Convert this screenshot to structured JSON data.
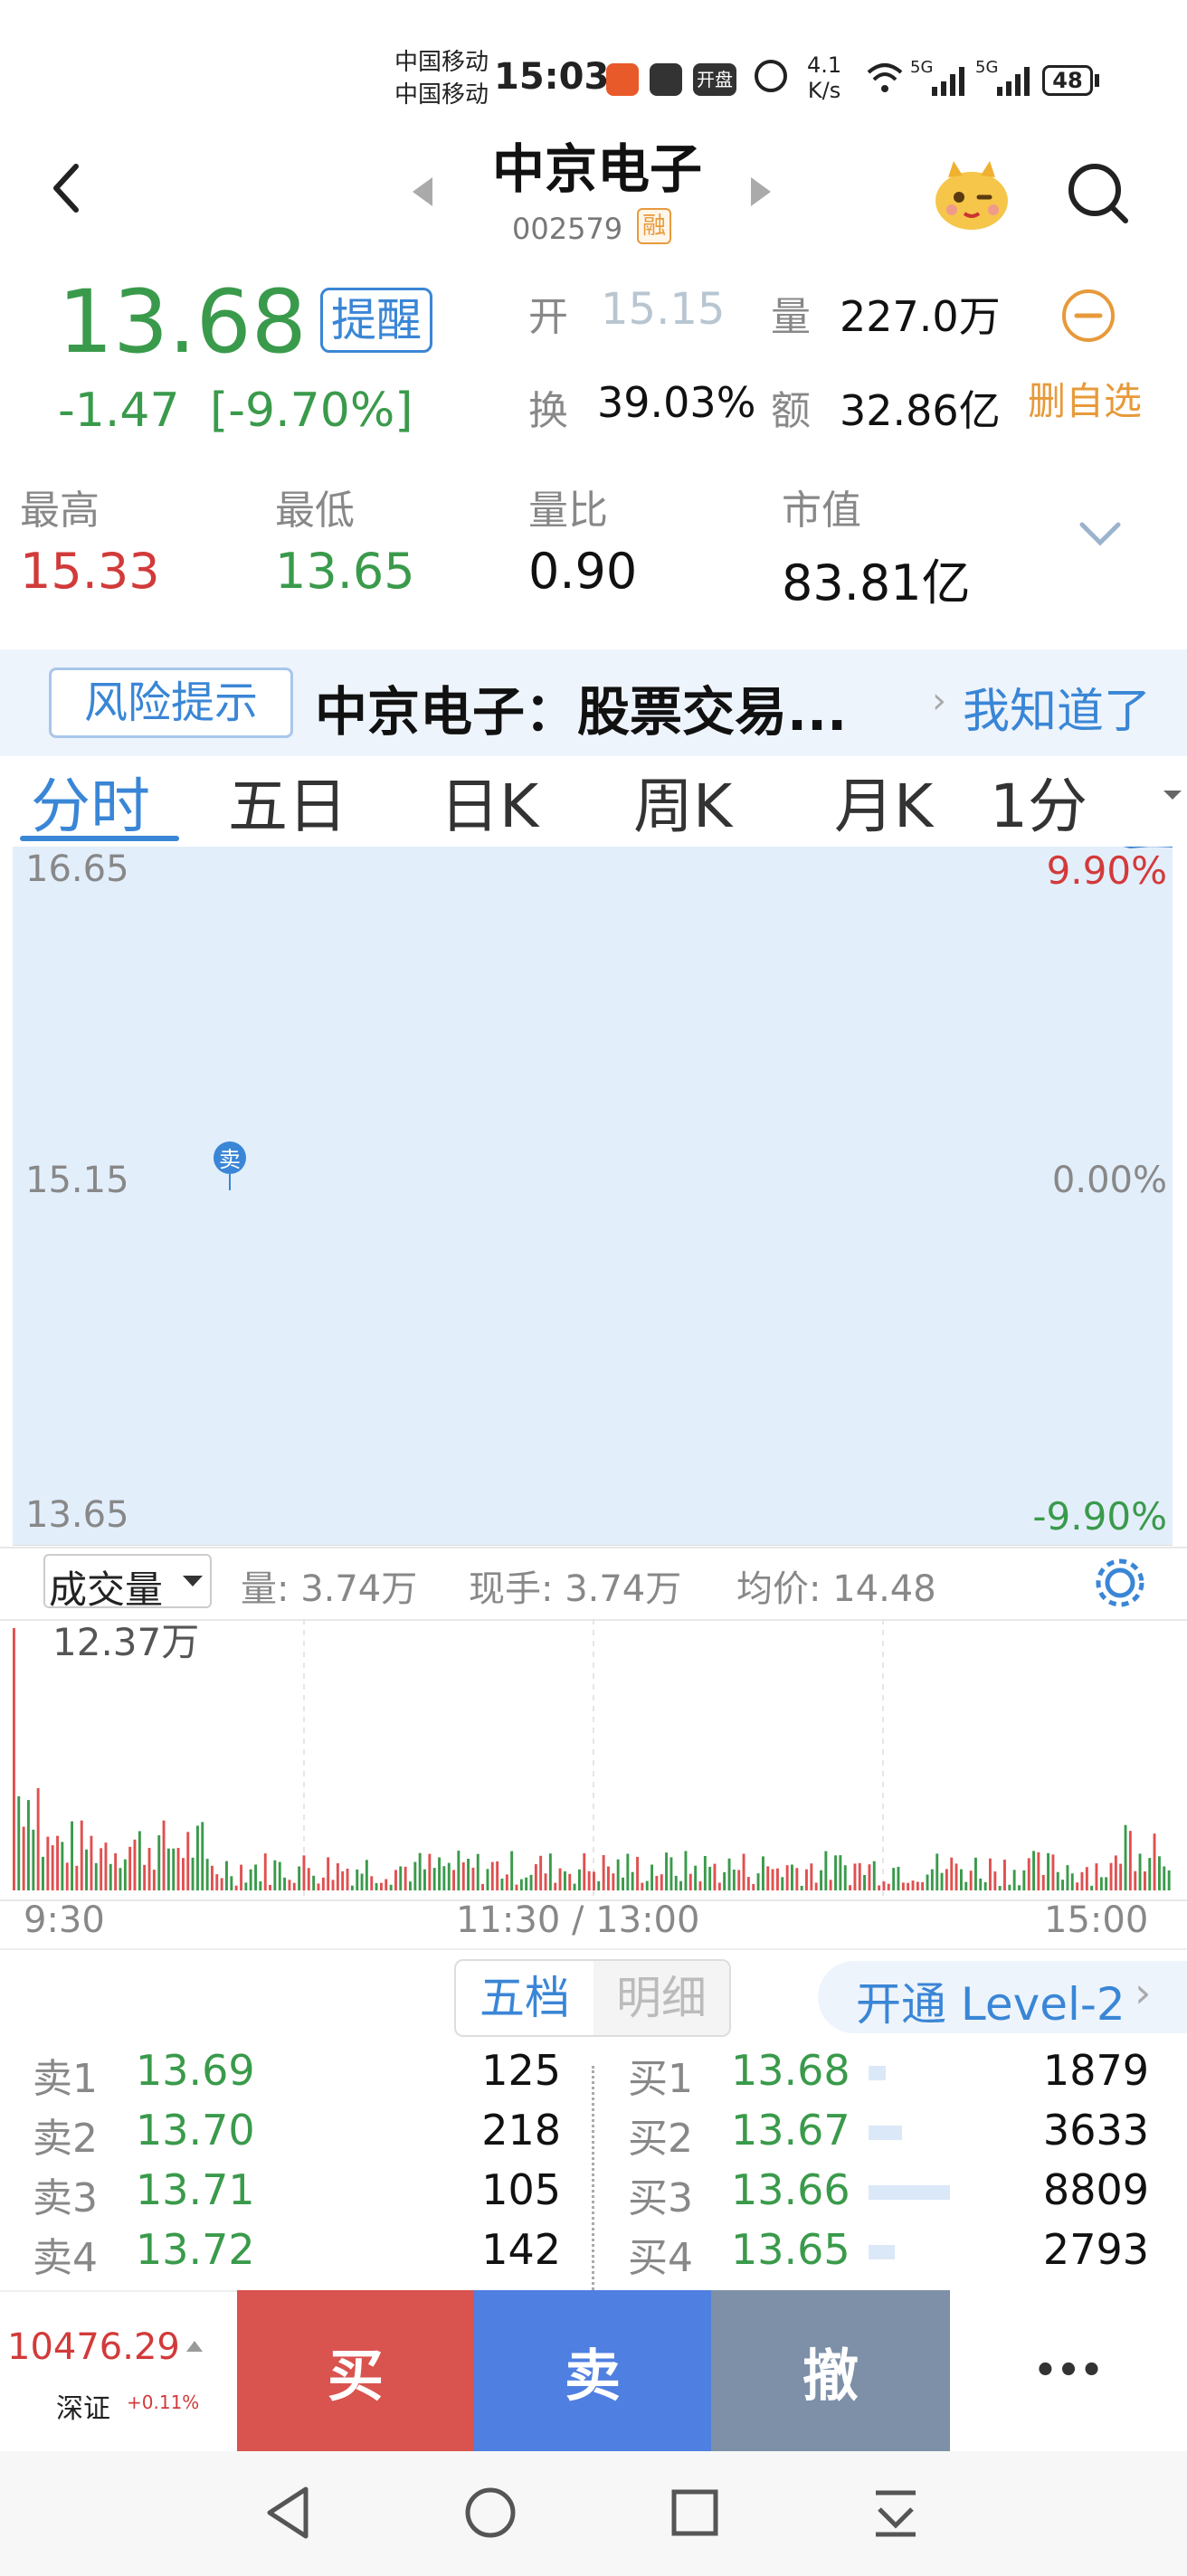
{
  "status_bar": {
    "carrier1": "中国移动",
    "carrier2": "中国移动",
    "time": "15:03",
    "net_speed_value": "4.1",
    "net_speed_unit": "K/s",
    "signal1": "5G",
    "signal2": "5G",
    "battery": "48",
    "app_badge": "开盘"
  },
  "header": {
    "stock_name": "中京电子",
    "stock_code": "002579",
    "margin_badge": "融"
  },
  "quote": {
    "price": "13.68",
    "change": "-1.47",
    "change_pct": "[-9.70%]",
    "alert_button": "提醒",
    "open_label": "开",
    "open_value": "15.15",
    "volume_label": "量",
    "volume_value": "227.0万",
    "turnover_label": "换",
    "turnover_value": "39.03%",
    "amount_label": "额",
    "amount_value": "32.86亿",
    "remove_watch": "删自选",
    "high_label": "最高",
    "high_value": "15.33",
    "low_label": "最低",
    "low_value": "13.65",
    "vol_ratio_label": "量比",
    "vol_ratio_value": "0.90",
    "market_cap_label": "市值",
    "market_cap_value": "83.81亿"
  },
  "risk_banner": {
    "tag": "风险提示",
    "text": "中京电子：股票交易...",
    "ack": "我知道了"
  },
  "tabs": [
    "分时",
    "五日",
    "日K",
    "周K",
    "月K",
    "1分"
  ],
  "chart": {
    "y_top": "16.65",
    "y_mid": "15.15",
    "y_bottom": "13.65",
    "pct_top": "9.90%",
    "pct_mid": "0.00%",
    "pct_bottom": "-9.90%",
    "sell_marker": "卖",
    "colors": {
      "price_line": "#3a7fd0",
      "avg_line": "#e79a3a",
      "fill": "#e3eefb"
    }
  },
  "volume_panel": {
    "selector": "成交量",
    "vol": "量: 3.74万",
    "current": "现手: 3.74万",
    "avg_price": "均价: 14.48",
    "max_label": "12.37万"
  },
  "time_axis": {
    "start": "9:30",
    "mid": "11:30 / 13:00",
    "end": "15:00"
  },
  "order_book": {
    "tab_active": "五档",
    "tab_inactive": "明细",
    "level2": "开通 Level-2",
    "asks": [
      {
        "label": "卖1",
        "price": "13.69",
        "volume": "125"
      },
      {
        "label": "卖2",
        "price": "13.70",
        "volume": "218"
      },
      {
        "label": "卖3",
        "price": "13.71",
        "volume": "105"
      },
      {
        "label": "卖4",
        "price": "13.72",
        "volume": "142"
      }
    ],
    "bids": [
      {
        "label": "买1",
        "price": "13.68",
        "volume": "1879",
        "bar": 0.21
      },
      {
        "label": "买2",
        "price": "13.67",
        "volume": "3633",
        "bar": 0.41
      },
      {
        "label": "买3",
        "price": "13.66",
        "volume": "8809",
        "bar": 1.0
      },
      {
        "label": "买4",
        "price": "13.65",
        "volume": "2793",
        "bar": 0.32
      }
    ]
  },
  "index_ticker": {
    "value": "10476.29",
    "name": "深证",
    "change": "+0.11%"
  },
  "trade_buttons": {
    "buy": "买",
    "sell": "卖",
    "cancel": "撤",
    "more": "•••"
  }
}
